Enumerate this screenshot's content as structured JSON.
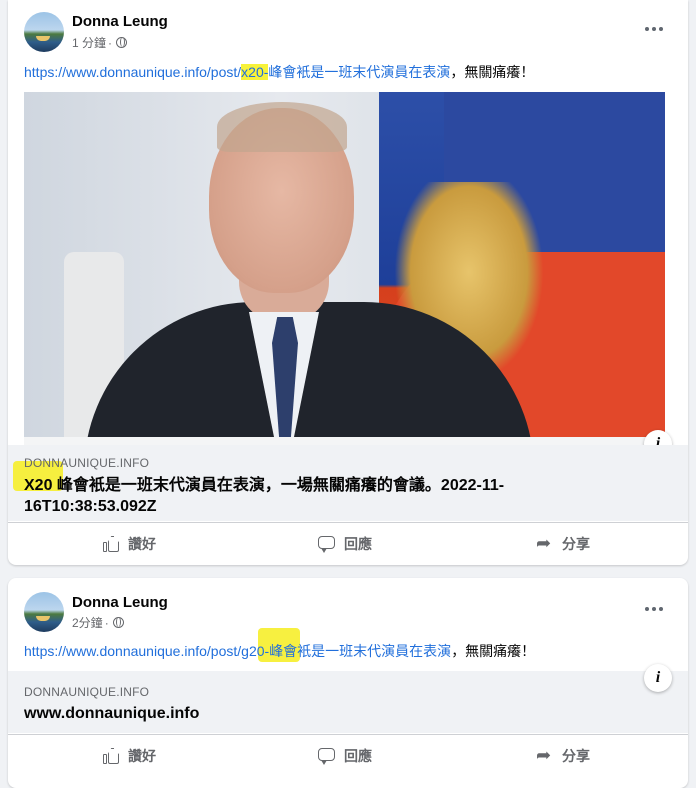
{
  "posts": [
    {
      "author": "Donna Leung",
      "time": "1 分鐘",
      "separator": "·",
      "text_link_pre": "https://www.donnaunique.info/post/",
      "text_link_hl": "x20-",
      "text_link_post": "峰會衹是一班末代演員在表演",
      "text_rest": "，無關痛癢！",
      "preview": {
        "domain": "DONNAUNIQUE.INFO",
        "title_hl": "X20",
        "title_rest": " 峰會衹是一班末代演員在表演，一場無關痛癢的會議。2022-11-16T10:38:53.092Z"
      }
    },
    {
      "author": "Donna Leung",
      "time": "2分鐘",
      "separator": "·",
      "text_link_pre": "https://www.donnaunique.info/post/",
      "text_link_hl": "g20-",
      "text_link_post": "峰會衹是一班末代演員在表演",
      "text_rest": "，無關痛癢！",
      "preview": {
        "domain": "DONNAUNIQUE.INFO",
        "title": "www.donnaunique.info"
      }
    }
  ],
  "actions": {
    "like": "讚好",
    "comment": "回應",
    "share": "分享"
  },
  "icons": [
    "avatar",
    "globe-icon",
    "more-options-icon",
    "info-icon",
    "like-icon",
    "comment-icon",
    "share-icon"
  ],
  "colors": {
    "link": "#216fdb",
    "highlight": "#f7f23a",
    "muted": "#65676b"
  }
}
